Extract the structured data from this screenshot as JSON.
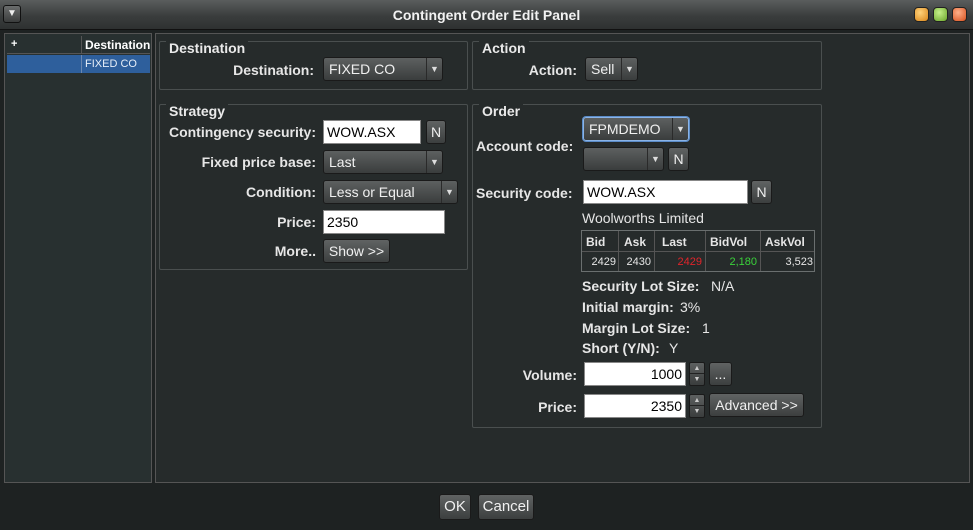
{
  "window": {
    "title": "Contingent Order Edit Panel"
  },
  "left_pane": {
    "header_plus": "+",
    "header_destination": "Destination",
    "rows": [
      {
        "destination": "FIXED CO"
      }
    ]
  },
  "destination_group": {
    "title": "Destination",
    "label": "Destination:",
    "value": "FIXED CO"
  },
  "action_group": {
    "title": "Action",
    "label": "Action:",
    "value": "Sell"
  },
  "strategy_group": {
    "title": "Strategy",
    "contingency_security_label": "Contingency security:",
    "contingency_security_value": "WOW.ASX",
    "n_button": "N",
    "fixed_price_base_label": "Fixed price base:",
    "fixed_price_base_value": "Last",
    "condition_label": "Condition:",
    "condition_value": "Less or Equal",
    "price_label": "Price:",
    "price_value": "2350",
    "more_label": "More..",
    "show_button": "Show >>"
  },
  "order_group": {
    "title": "Order",
    "account_code_label": "Account code:",
    "account_code_value": "FPMDEMO",
    "account_sub_value": "",
    "n_button": "N",
    "security_code_label": "Security code:",
    "security_code_value": "WOW.ASX",
    "security_name": "Woolworths Limited",
    "quote": {
      "headers": [
        "Bid",
        "Ask",
        "Last",
        "BidVol",
        "AskVol"
      ],
      "values": [
        "2429",
        "2430",
        "2429",
        "2,180",
        "3,523"
      ],
      "colors": {
        "last": "#e0242a",
        "bidvol": "#3ad23a",
        "default": "#e6e6e6"
      }
    },
    "security_lot_size_label": "Security Lot Size:",
    "security_lot_size_value": "N/A",
    "initial_margin_label": "Initial margin:",
    "initial_margin_value": "3%",
    "margin_lot_size_label": "Margin Lot Size:",
    "margin_lot_size_value": "1",
    "short_label": "Short (Y/N):",
    "short_value": "Y",
    "volume_label": "Volume:",
    "volume_value": "1000",
    "ellipsis_button": "...",
    "price_label": "Price:",
    "price_value": "2350",
    "advanced_button": "Advanced >>"
  },
  "footer": {
    "ok_label": "OK",
    "cancel_label": "Cancel"
  }
}
